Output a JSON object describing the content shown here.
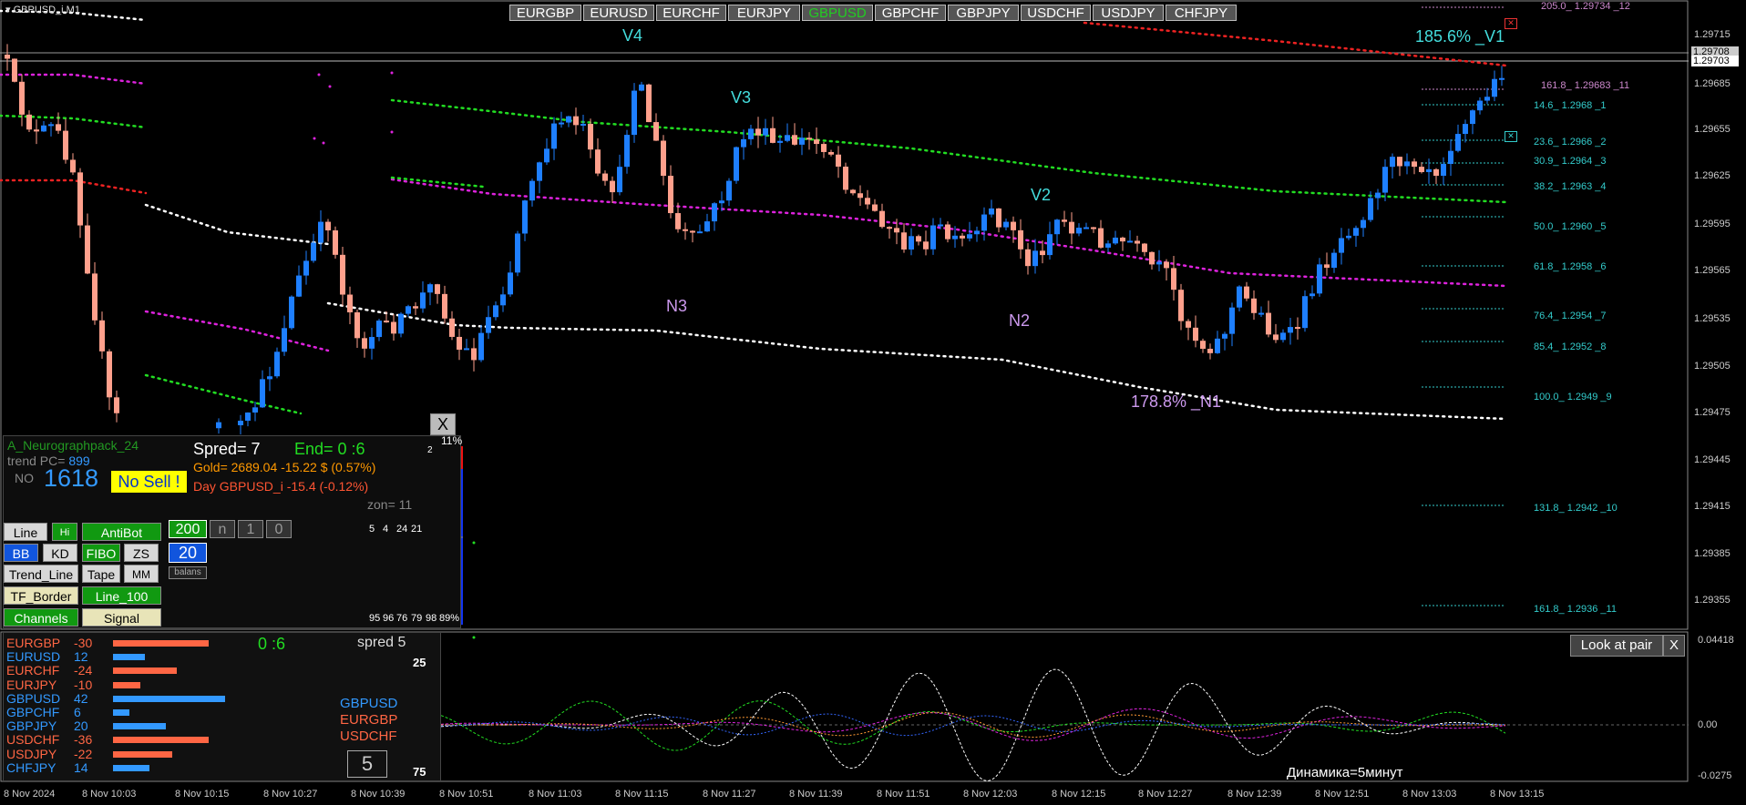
{
  "window": {
    "title": "GBPUSD_i,M1"
  },
  "pair_buttons": [
    {
      "label": "EURGBP",
      "active": false
    },
    {
      "label": "EURUSD",
      "active": false
    },
    {
      "label": "EURCHF",
      "active": false
    },
    {
      "label": "EURJPY",
      "active": false
    },
    {
      "label": "GBPUSD",
      "active": true
    },
    {
      "label": "GBPCHF",
      "active": false
    },
    {
      "label": "GBPJPY",
      "active": false
    },
    {
      "label": "USDCHF",
      "active": false
    },
    {
      "label": "USDJPY",
      "active": false
    },
    {
      "label": "CHFJPY",
      "active": false
    }
  ],
  "price_axis": {
    "labels": [
      "1.29715",
      "1.29685",
      "1.29655",
      "1.29625",
      "1.29595",
      "1.29565",
      "1.29535",
      "1.29505",
      "1.29475",
      "1.29445",
      "1.29415",
      "1.29385",
      "1.29355"
    ],
    "current_ask": "1.29708",
    "current_bid": "1.29703"
  },
  "time_axis": [
    "8 Nov 2024",
    "8 Nov 10:03",
    "8 Nov 10:15",
    "8 Nov 10:27",
    "8 Nov 10:39",
    "8 Nov 10:51",
    "8 Nov 11:03",
    "8 Nov 11:15",
    "8 Nov 11:27",
    "8 Nov 11:39",
    "8 Nov 11:51",
    "8 Nov 12:03",
    "8 Nov 12:15",
    "8 Nov 12:27",
    "8 Nov 12:39",
    "8 Nov 12:51",
    "8 Nov 13:03",
    "8 Nov 13:15"
  ],
  "fibo_levels": [
    {
      "text": "205.0_ 1.29734 _12",
      "color": "#cc88cc"
    },
    {
      "text": "161.8_ 1.29683 _11",
      "color": "#cc88cc"
    },
    {
      "text": "14.6_ 1.2968 _1",
      "color": "#33cccc"
    },
    {
      "text": "23.6_ 1.2966 _2",
      "color": "#33cccc"
    },
    {
      "text": "30.9_ 1.2964 _3",
      "color": "#33cccc"
    },
    {
      "text": "38.2_ 1.2963 _4",
      "color": "#33cccc"
    },
    {
      "text": "50.0_ 1.2960 _5",
      "color": "#33cccc"
    },
    {
      "text": "61.8_ 1.2958 _6",
      "color": "#33cccc"
    },
    {
      "text": "76.4_ 1.2954 _7",
      "color": "#33cccc"
    },
    {
      "text": "85.4_ 1.2952 _8",
      "color": "#33cccc"
    },
    {
      "text": "100.0_ 1.2949 _9",
      "color": "#33cccc"
    },
    {
      "text": "131.8_ 1.2942 _10",
      "color": "#33cccc"
    },
    {
      "text": "161.8_ 1.2936 _11",
      "color": "#33cccc"
    }
  ],
  "wave_labels": {
    "v4": "V4",
    "v3": "V3",
    "v2": "V2",
    "v1": "185.6% _V1",
    "n3": "N3",
    "n2": "N2",
    "n1": "178.8% _N1"
  },
  "panel": {
    "indicator_name": "A_Neurographpack_24",
    "trend_label": "trend PC=",
    "trend_value": "899",
    "no_label": "NO",
    "big_number": "1618",
    "no_sell": "No Sell !",
    "spread": "Spred= 7",
    "end": "End= 0 :6",
    "gold": "Gold= 2689.04 -15.22 $ (0.57%)",
    "day": "Day GBPUSD_i   -15.4 (-0.12%)",
    "zon": "zon= 11",
    "close_x": "X",
    "pct_top": "11%",
    "bar_top_label": "2",
    "bars_top": [
      "5",
      "4",
      "24",
      "21"
    ],
    "bars_bottom": [
      "95",
      "96",
      "76",
      "79",
      "98",
      "89%"
    ],
    "buttons": {
      "line": "Line",
      "hi": "Hi",
      "antibot": "AntiBot",
      "bb": "BB",
      "kd": "KD",
      "fibo": "FIBO",
      "zs": "ZS",
      "trend_line": "Trend_Line",
      "tape": "Tape",
      "mm": "MM",
      "tf_border": "TF_Border",
      "line_100": "Line_100",
      "channels": "Channels",
      "signal": "Signal",
      "n200": "200",
      "n": "n",
      "n1": "1",
      "n0": "0",
      "n20": "20",
      "balans": "balans"
    }
  },
  "strength_panel": {
    "rows": [
      {
        "pair": "EURGBP",
        "value": "-30",
        "color": "#ff6644",
        "bar": 0.42
      },
      {
        "pair": "EURUSD",
        "value": "12",
        "color": "#3399ff",
        "bar": 0.14
      },
      {
        "pair": "EURCHF",
        "value": "-24",
        "color": "#ff6644",
        "bar": 0.28
      },
      {
        "pair": "EURJPY",
        "value": "-10",
        "color": "#ff6644",
        "bar": 0.12
      },
      {
        "pair": "GBPUSD",
        "value": "42",
        "color": "#3399ff",
        "bar": 0.49
      },
      {
        "pair": "GBPCHF",
        "value": "6",
        "color": "#3399ff",
        "bar": 0.07
      },
      {
        "pair": "GBPJPY",
        "value": "20",
        "color": "#3399ff",
        "bar": 0.23
      },
      {
        "pair": "USDCHF",
        "value": "-36",
        "color": "#ff6644",
        "bar": 0.42
      },
      {
        "pair": "USDJPY",
        "value": "-22",
        "color": "#ff6644",
        "bar": 0.26
      },
      {
        "pair": "CHFJPY",
        "value": "14",
        "color": "#3399ff",
        "bar": 0.16
      }
    ],
    "timer": "0 :6",
    "spread": "spred 5",
    "top3": [
      {
        "pair": "GBPUSD",
        "color": "#3399ff"
      },
      {
        "pair": "EURGBP",
        "color": "#ff6644"
      },
      {
        "pair": "USDCHF",
        "color": "#ff6644"
      }
    ],
    "count_box": "5",
    "side_top": "25",
    "side_bottom": "75"
  },
  "subwindow": {
    "look_at_pair": "Look at pair",
    "close": "X",
    "axis": [
      "0.04418",
      "0.00",
      "-0.0275"
    ],
    "dynamics": "Динамика=5минут"
  },
  "colors": {
    "bull": "#1e7fff",
    "bear": "#ffa08c",
    "ma_green": "#22dd22",
    "ma_magenta": "#dd22dd",
    "ma_white": "#ffffff",
    "ma_red": "#ee2222"
  }
}
